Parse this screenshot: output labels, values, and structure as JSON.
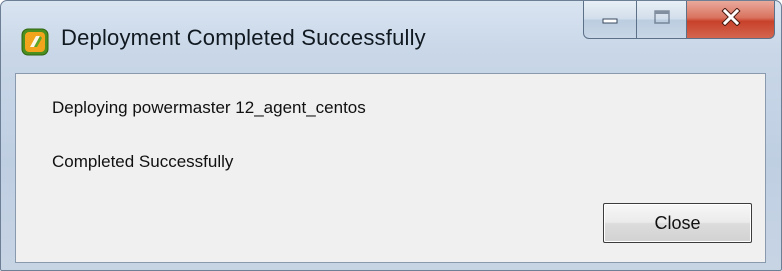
{
  "window": {
    "title": "Deployment Completed Successfully",
    "icon": "app-logo-icon",
    "controls": {
      "minimize_icon": "minimize-icon",
      "maximize_icon": "maximize-icon",
      "close_icon": "close-icon",
      "close_color": "#c8412a"
    }
  },
  "content": {
    "deploying_text": "Deploying powermaster 12_agent_centos",
    "status_text": "Completed Successfully"
  },
  "buttons": {
    "close_label": "Close"
  }
}
